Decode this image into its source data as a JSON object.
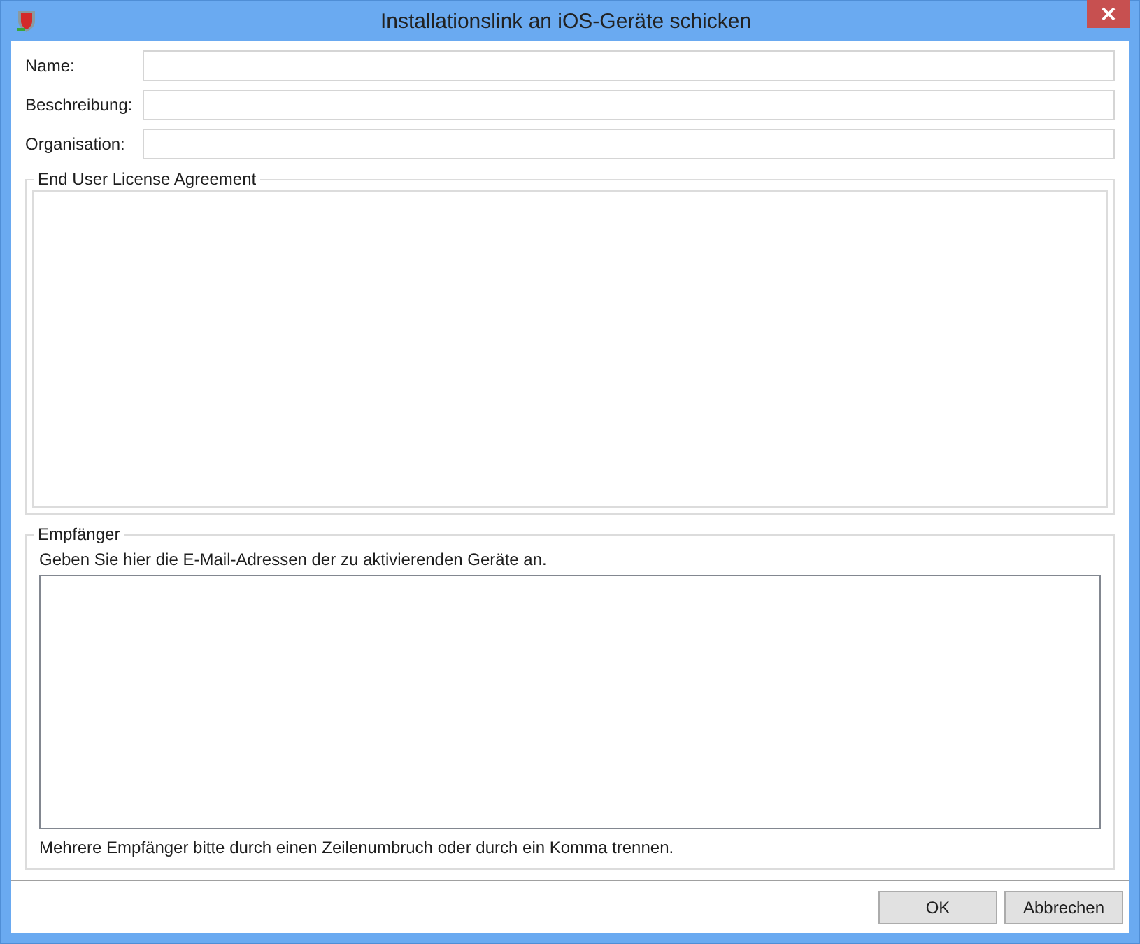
{
  "window": {
    "title": "Installationslink an iOS-Geräte schicken",
    "close": "×"
  },
  "fields": [
    {
      "label": "Name:"
    },
    {
      "label": "Beschreibung:"
    },
    {
      "label": "Organisation:"
    }
  ],
  "eula": {
    "title": "End User License Agreement"
  },
  "recipients": {
    "title": "Empfänger",
    "instruction": "Geben Sie hier die E-Mail-Adressen der zu aktivierenden Geräte an.",
    "hint": "Mehrere Empfänger bitte durch einen Zeilenumbruch oder durch ein Komma trennen."
  },
  "buttons": [
    "OK",
    "Abbrechen"
  ]
}
